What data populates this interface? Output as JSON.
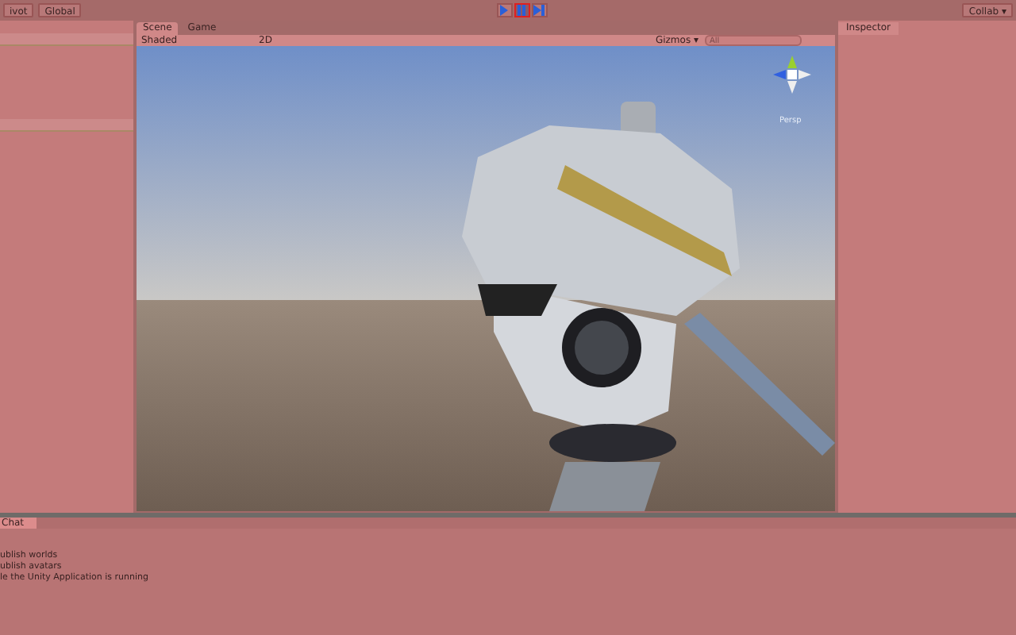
{
  "toolbar": {
    "pivot_button": "ivot",
    "global_button": "Global",
    "play_controls": [
      {
        "kind": "play",
        "selected": false
      },
      {
        "kind": "pause",
        "selected": true
      },
      {
        "kind": "step",
        "selected": false
      }
    ],
    "collab_button": "Collab ▾"
  },
  "scene_tabs": [
    {
      "label": "Scene",
      "selected": true
    },
    {
      "label": "Game",
      "selected": false
    }
  ],
  "scene_toolbar": {
    "shading": "Shaded",
    "mode_2d": "2D",
    "gizmos": "Gizmos ▾",
    "search_placeholder": "All"
  },
  "scene_view": {
    "gizmo_label": "Persp"
  },
  "inspector": {
    "tab": "Inspector"
  },
  "console": {
    "tab": "Chat",
    "lines": [
      "ublish worlds",
      "ublish avatars",
      "le the Unity Application is running"
    ]
  }
}
